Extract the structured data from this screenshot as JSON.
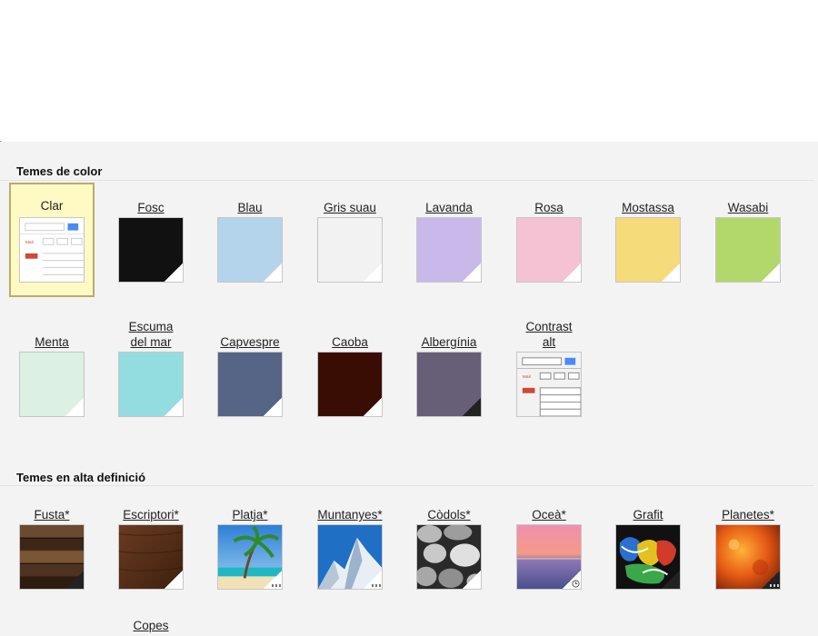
{
  "sections": {
    "color_title": "Temes de color",
    "hd_title": "Temes en alta definició"
  },
  "color_themes": [
    {
      "label": "Clar",
      "color": "#ffffff",
      "selected": true
    },
    {
      "label": "Fosc",
      "color": "#111111"
    },
    {
      "label": "Blau",
      "color": "#b4d4ec"
    },
    {
      "label": "Gris suau",
      "color": "#f2f2f2"
    },
    {
      "label": "Lavanda",
      "color": "#c9b9ea"
    },
    {
      "label": "Rosa",
      "color": "#f4c2d3"
    },
    {
      "label": "Mostassa",
      "color": "#f6db7a"
    },
    {
      "label": "Wasabi",
      "color": "#b2d86c"
    },
    {
      "label": "Menta",
      "color": "#dcf0e3"
    },
    {
      "label": "Escuma del mar",
      "color": "#93dde0"
    },
    {
      "label": "Capvespre",
      "color": "#566486"
    },
    {
      "label": "Caoba",
      "color": "#3a0d04"
    },
    {
      "label": "Albergínia",
      "color": "#675f78"
    },
    {
      "label": "Contrast alt",
      "color": "#f2f2f2"
    }
  ],
  "hd_themes": [
    {
      "label": "Fusta*",
      "icon": "wood-icon"
    },
    {
      "label": "Escriptori*",
      "icon": "desk-icon"
    },
    {
      "label": "Platja*",
      "icon": "beach-icon"
    },
    {
      "label": "Muntanyes*",
      "icon": "mountain-icon"
    },
    {
      "label": "Còdols*",
      "icon": "pebbles-icon"
    },
    {
      "label": "Oceà*",
      "icon": "ocean-icon"
    },
    {
      "label": "Grafit",
      "icon": "graffiti-icon"
    },
    {
      "label": "Planetes*",
      "icon": "planet-icon"
    },
    {
      "label": "Copes",
      "icon": "cups-icon"
    }
  ]
}
